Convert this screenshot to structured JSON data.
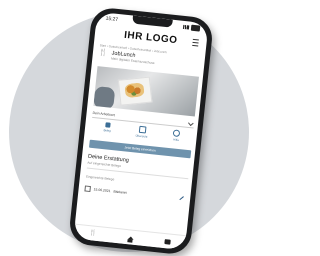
{
  "status_bar": {
    "time": "15:27"
  },
  "header": {
    "logo_text": "IHR LOGO"
  },
  "breadcrumb": "Start › Gutscheinheft › Gutscheinartikel › JobLunch",
  "app": {
    "title": "JobLunch",
    "subtitle": "Mein digitaler Essenszuschuss"
  },
  "employer_select": {
    "value": "Dein Arbeitsort"
  },
  "actions": [
    {
      "label": "Beleg",
      "icon": "receipt-icon"
    },
    {
      "label": "Übersicht",
      "icon": "document-icon"
    },
    {
      "label": "Hilfe",
      "icon": "help-icon"
    }
  ],
  "cta": {
    "label": "Jetzt Beleg einreichen"
  },
  "refund": {
    "title": "Deine Erstattung",
    "subtitle": "Auf eingereichte Belege"
  },
  "receipts": {
    "label": "Eingereichte Belege",
    "items": [
      {
        "date": "15.06.2021",
        "vendor": "Bäckerei"
      }
    ]
  },
  "nav": [
    {
      "icon": "cutlery-icon"
    },
    {
      "icon": "home-icon"
    },
    {
      "icon": "bag-icon"
    }
  ],
  "colors": {
    "accent": "#6f93ad",
    "primary": "#3c6e96",
    "background_circle": "#d5d8dc",
    "phone": "#1b1c1e"
  }
}
